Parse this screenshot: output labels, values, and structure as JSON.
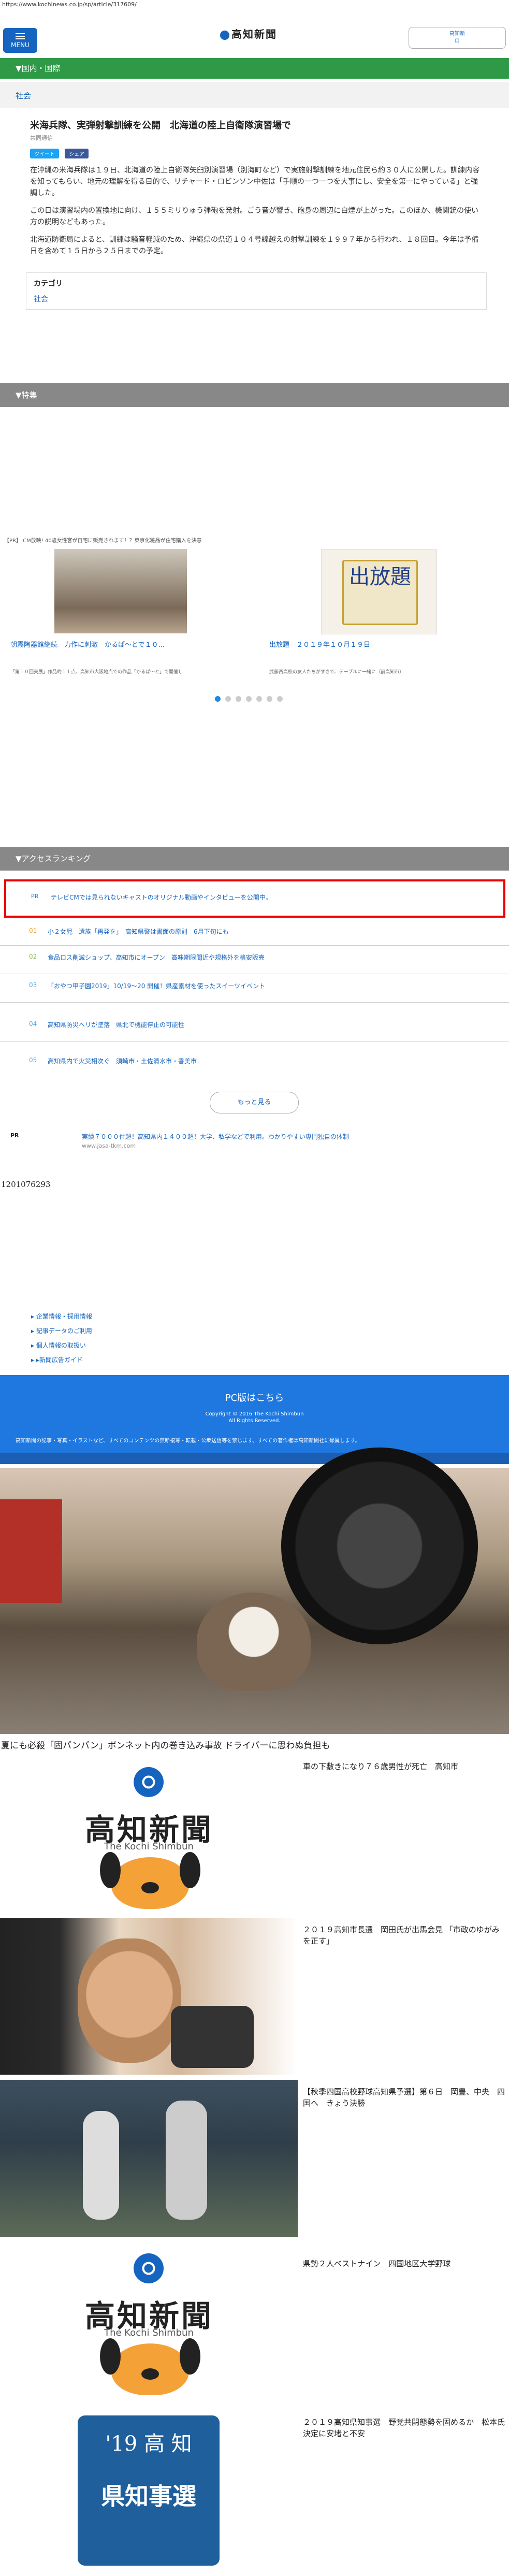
{
  "browser": {
    "url": "https://www.kochinews.co.jp/sp/article/317609/"
  },
  "header": {
    "menu_label": "MENU",
    "logo_text": "高知新聞",
    "login_label_1": "高知新",
    "login_label_2": "ロ"
  },
  "section_bar": {
    "label": "▼国内・国際"
  },
  "category_strip": {
    "label": "社会"
  },
  "article": {
    "headline": "米海兵隊、実弾射撃訓練を公開　北海道の陸上自衛隊演習場で",
    "date": "共同通信",
    "share_twitter": "ツイート",
    "share_facebook": "シェア",
    "paragraphs": [
      "在沖縄の米海兵隊は１９日、北海道の陸上自衛隊矢臼別演習場（別海町など）で実施射撃訓練を地元住民ら約３０人に公開した。訓練内容を知ってもらい、地元の理解を得る目的で、リチャード・ロビンソン中佐は「手順の一つ一つを大事にし、安全を第一にやっている」と強調した。",
      "この日は演習場内の置換地に向け、１５５ミリりゅう弾砲を発射。ごう音が響き、砲身の周辺に白煙が上がった。このほか、機関銃の使い方の説明などもあった。",
      "北海道防衛局によると、訓練は騒音軽減のため、沖縄県の県道１０４号線越えの射撃訓練を１９９７年から行われ、１８回目。今年は予備日を含めて１５日から２５日までの予定。"
    ],
    "category_heading": "カテゴリ",
    "category_value": "社会"
  },
  "features": {
    "bar_label": "▼特集",
    "pr_line": "【PR】 CM放映! 40歳女性客が自宅に販売されます！？東京化粧品が住宅購入を決意",
    "item1_title": "朝霧陶器館継続　力作に刺激　かるぱ～とで１０...",
    "item1_desc": "「第１０回美展」作品約１１点、高知市大阪地点での作品「かるぱ～と」で開催し",
    "item2_stamp": "出放題",
    "item2_title": "出放題　２０１９年１０月１９日",
    "item2_desc": "武藤西高校の友人たちがすきで、テーブルに一緒に（前高知市）",
    "slides_total": 7,
    "slides_active": 1
  },
  "ranking": {
    "bar_label": "▼アクセスランキング",
    "pr_label": "PR",
    "pr_text": "テレビCMでは見られないキャストのオリジナル動画やインタビューを公開中。",
    "items": [
      {
        "num": "01",
        "text": "小２女児　遺族「再発を」　高知県警は書面の原則　6月下旬にも"
      },
      {
        "num": "02",
        "text": "食品ロス削減ショップ、高知市にオープン　賞味期限間近や規格外を格安販売"
      },
      {
        "num": "03",
        "text": "「おやつ甲子園2019」10/19～20 開催！県産素材を使ったスイーツイベント"
      },
      {
        "num": "04",
        "text": "高知県防災ヘリが墜落　県北で機能停止の可能性"
      },
      {
        "num": "05",
        "text": "高知県内で火災相次ぐ　須崎市・土佐清水市・香美市"
      }
    ],
    "more_label": "もっと見る"
  },
  "pr_ad": {
    "label": "PR",
    "link": "実績７０００件超！高知県内１４００超！大学、私学などで利用。わかりやすい専門独自の体制",
    "site": "www.jasa-tkm.com"
  },
  "ad_number": "1201076293",
  "footer": {
    "links": [
      "▸ 企業情報・採用情報",
      "▸ 記事データのご利用",
      "▸ 個人情報の取扱い",
      "▸ ▸新聞広告ガイド"
    ],
    "pc_link": "PC版はこちら",
    "copyright_1": "Copyright © 2016 The Kochi Shimbun",
    "copyright_2": "All Rights Reserved.",
    "note": "高知新聞の記事・写真・イラストなど、すべてのコンテンツの無断複写・転載・公衆送信等を禁じます。すべての著作権は高知新聞社に帰属します。"
  },
  "photo_story": {
    "title": "夏にも必殺「固パンパン」ボンネット内の巻き込み事故 ドライバーに思わぬ負担も"
  },
  "news_list": [
    {
      "title": "車の下敷きになり７６歳男性が死亡　高知市",
      "img": "kochi-logo"
    },
    {
      "title": "２０１９高知市長選　岡田氏が出馬会見 「市政のゆがみを正す」",
      "img": "portrait"
    },
    {
      "title": "【秋季四国高校野球高知県予選】第６日　岡豊、中央　四国へ　きょう決勝",
      "img": "baseball"
    },
    {
      "title": "県勢２人ベストナイン　四国地区大学野球",
      "img": "kochi-logo"
    },
    {
      "title": "２０１９高知県知事選　野党共闘態勢を固めるか　松本氏決定に安堵と不安",
      "img": "election"
    }
  ],
  "kochi_logo": {
    "name": "高知新聞",
    "en": "The Kochi Shimbun"
  },
  "election_badge": {
    "year": "'19 高 知",
    "title": "県知事選"
  },
  "colors": {
    "green": "#2e9a48",
    "grey": "#888888",
    "blue": "#1e78e0",
    "accent": "#1565c0",
    "alert": "#ee0000"
  }
}
